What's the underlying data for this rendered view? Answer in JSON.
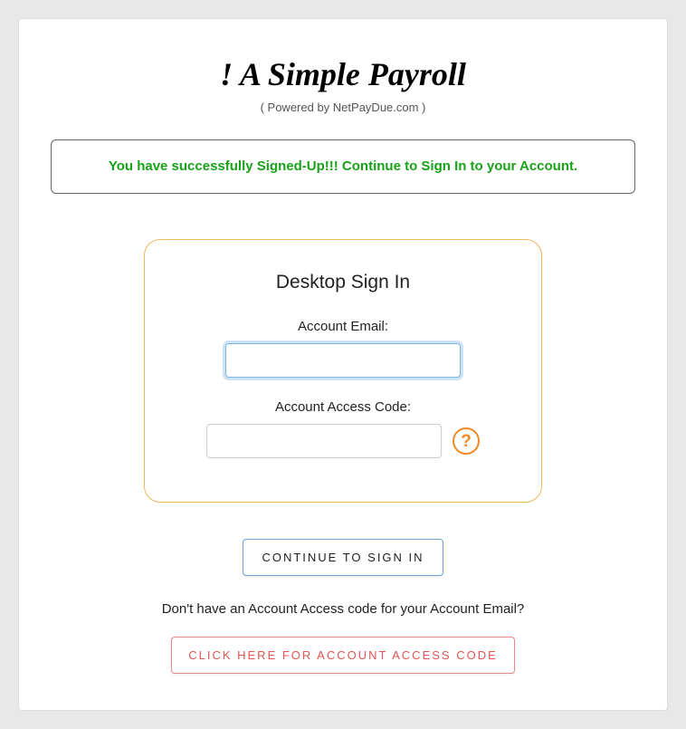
{
  "brand": {
    "title": "! A Simple Payroll",
    "subtitle": "( Powered by NetPayDue.com )"
  },
  "banner": {
    "message": "You have successfully Signed-Up!!! Continue to Sign In to your Account."
  },
  "signin": {
    "panel_title": "Desktop Sign In",
    "email_label": "Account Email:",
    "email_value": "",
    "code_label": "Account Access Code:",
    "code_value": "",
    "help_glyph": "?"
  },
  "actions": {
    "continue_label": "CONTINUE TO SIGN IN",
    "helper_text": "Don't have an Account Access code for your Account Email?",
    "get_code_label": "CLICK HERE FOR ACCOUNT ACCESS CODE"
  }
}
